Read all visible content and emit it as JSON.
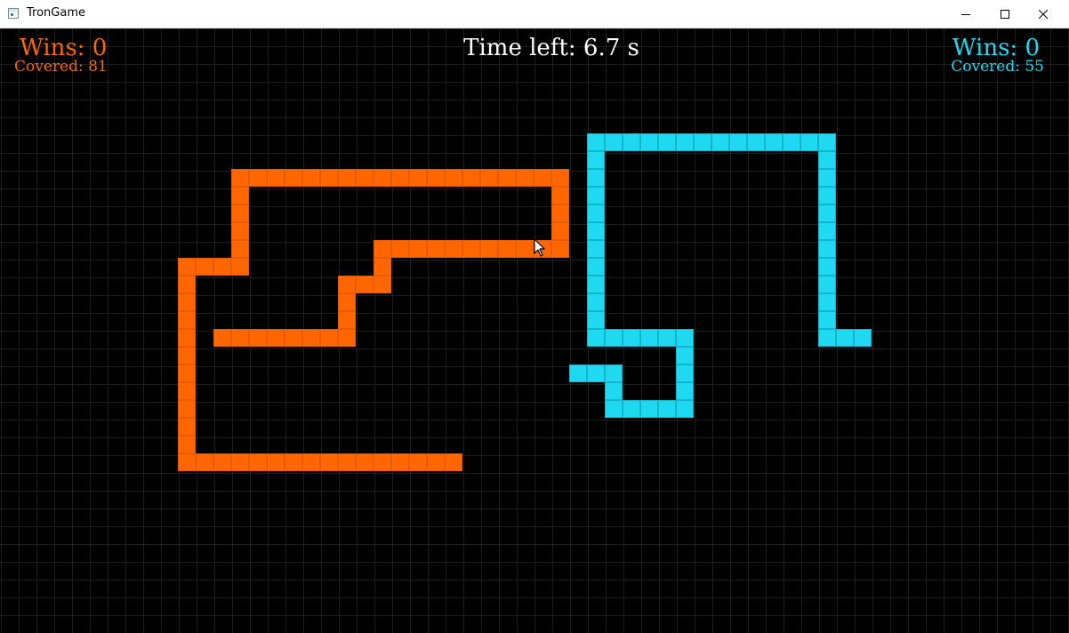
{
  "window": {
    "title": "TronGame"
  },
  "colors": {
    "player1": "#ff6600",
    "player1_cell_border": "#e65c00",
    "player2": "#1ed9f0",
    "player2_cell_border": "#12b4cc",
    "background": "#000000",
    "grid_line": "#1e1e1e",
    "text": "#ffffff"
  },
  "hud": {
    "player1": {
      "wins": "Wins: 0",
      "covered": "Covered: 81"
    },
    "player2": {
      "wins": "Wins: 0",
      "covered": "Covered: 55"
    },
    "time_left": "Time left: 6.7 s"
  },
  "players": [
    {
      "name": "player1",
      "cells": [
        [
          210,
          520
        ],
        [
          210,
          500
        ],
        [
          210,
          480
        ],
        [
          210,
          460
        ],
        [
          210,
          440
        ],
        [
          210,
          420
        ],
        [
          210,
          400
        ],
        [
          210,
          380
        ],
        [
          210,
          360
        ],
        [
          210,
          340
        ],
        [
          210,
          320
        ],
        [
          210,
          300
        ],
        [
          230,
          300
        ],
        [
          250,
          300
        ],
        [
          270,
          300
        ],
        [
          270,
          280
        ],
        [
          270,
          260
        ],
        [
          270,
          240
        ],
        [
          270,
          220
        ],
        [
          270,
          200
        ],
        [
          290,
          200
        ],
        [
          310,
          200
        ],
        [
          330,
          200
        ],
        [
          350,
          200
        ],
        [
          370,
          200
        ],
        [
          390,
          200
        ],
        [
          410,
          200
        ],
        [
          430,
          200
        ],
        [
          450,
          200
        ],
        [
          470,
          200
        ],
        [
          490,
          200
        ],
        [
          510,
          200
        ],
        [
          530,
          200
        ],
        [
          550,
          200
        ],
        [
          570,
          200
        ],
        [
          590,
          200
        ],
        [
          610,
          200
        ],
        [
          630,
          200
        ],
        [
          630,
          220
        ],
        [
          630,
          240
        ],
        [
          630,
          260
        ],
        [
          630,
          280
        ],
        [
          610,
          280
        ],
        [
          590,
          280
        ],
        [
          570,
          280
        ],
        [
          550,
          280
        ],
        [
          530,
          280
        ],
        [
          510,
          280
        ],
        [
          490,
          280
        ],
        [
          470,
          280
        ],
        [
          450,
          280
        ],
        [
          430,
          280
        ],
        [
          430,
          300
        ],
        [
          430,
          320
        ],
        [
          410,
          320
        ],
        [
          390,
          320
        ],
        [
          390,
          340
        ],
        [
          390,
          360
        ],
        [
          390,
          380
        ],
        [
          370,
          380
        ],
        [
          350,
          380
        ],
        [
          330,
          380
        ],
        [
          310,
          380
        ],
        [
          290,
          380
        ],
        [
          270,
          380
        ],
        [
          250,
          380
        ],
        [
          230,
          520
        ],
        [
          250,
          520
        ],
        [
          270,
          520
        ],
        [
          290,
          520
        ],
        [
          310,
          520
        ],
        [
          330,
          520
        ],
        [
          350,
          520
        ],
        [
          370,
          520
        ],
        [
          390,
          520
        ],
        [
          410,
          520
        ],
        [
          430,
          520
        ],
        [
          450,
          520
        ],
        [
          470,
          520
        ],
        [
          490,
          520
        ],
        [
          510,
          520
        ]
      ]
    },
    {
      "name": "player2",
      "cells": [
        [
          670,
          160
        ],
        [
          690,
          160
        ],
        [
          710,
          160
        ],
        [
          730,
          160
        ],
        [
          750,
          160
        ],
        [
          770,
          160
        ],
        [
          790,
          160
        ],
        [
          810,
          160
        ],
        [
          830,
          160
        ],
        [
          850,
          160
        ],
        [
          870,
          160
        ],
        [
          890,
          160
        ],
        [
          910,
          160
        ],
        [
          930,
          160
        ],
        [
          930,
          180
        ],
        [
          930,
          200
        ],
        [
          930,
          220
        ],
        [
          930,
          240
        ],
        [
          930,
          260
        ],
        [
          930,
          280
        ],
        [
          930,
          300
        ],
        [
          930,
          320
        ],
        [
          930,
          340
        ],
        [
          930,
          360
        ],
        [
          930,
          380
        ],
        [
          950,
          380
        ],
        [
          970,
          380
        ],
        [
          670,
          180
        ],
        [
          670,
          200
        ],
        [
          670,
          220
        ],
        [
          670,
          240
        ],
        [
          670,
          260
        ],
        [
          670,
          280
        ],
        [
          670,
          300
        ],
        [
          670,
          320
        ],
        [
          670,
          340
        ],
        [
          670,
          360
        ],
        [
          670,
          380
        ],
        [
          690,
          380
        ],
        [
          710,
          380
        ],
        [
          730,
          380
        ],
        [
          750,
          380
        ],
        [
          770,
          380
        ],
        [
          770,
          400
        ],
        [
          770,
          420
        ],
        [
          770,
          440
        ],
        [
          770,
          460
        ],
        [
          750,
          460
        ],
        [
          730,
          460
        ],
        [
          710,
          460
        ],
        [
          690,
          460
        ],
        [
          690,
          440
        ],
        [
          690,
          420
        ],
        [
          670,
          420
        ],
        [
          650,
          420
        ]
      ]
    }
  ]
}
